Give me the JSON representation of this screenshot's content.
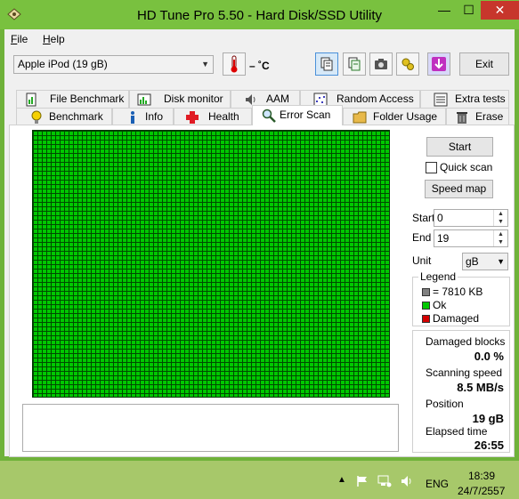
{
  "window": {
    "title": "HD Tune Pro 5.50 - Hard Disk/SSD Utility",
    "minimize_glyph": "—",
    "maximize_glyph": "☐",
    "close_glyph": "✕"
  },
  "menu": {
    "file": {
      "accel": "F",
      "rest": "ile"
    },
    "help": {
      "accel": "H",
      "rest": "elp"
    }
  },
  "toolbar": {
    "drive": "Apple   iPod (19 gB)",
    "temperature": "– ˚C",
    "exit_label": "Exit",
    "icons": [
      "thermometer-icon",
      "copy-info-icon",
      "copy-text-icon",
      "camera-icon",
      "options-icon",
      "save-icon"
    ]
  },
  "tabs": {
    "row1": [
      {
        "label": "File Benchmark",
        "icon": "file-benchmark-icon"
      },
      {
        "label": "Disk monitor",
        "icon": "disk-monitor-icon"
      },
      {
        "label": "AAM",
        "icon": "speaker-icon"
      },
      {
        "label": "Random Access",
        "icon": "random-access-icon"
      },
      {
        "label": "Extra tests",
        "icon": "extra-tests-icon"
      }
    ],
    "row2": [
      {
        "label": "Benchmark",
        "icon": "lightbulb-icon"
      },
      {
        "label": "Info",
        "icon": "info-icon"
      },
      {
        "label": "Health",
        "icon": "health-cross-icon"
      },
      {
        "label": "Error Scan",
        "icon": "magnifier-icon"
      },
      {
        "label": "Folder Usage",
        "icon": "folder-icon"
      },
      {
        "label": "Erase",
        "icon": "trash-icon"
      }
    ],
    "active": "Error Scan"
  },
  "scan": {
    "start_label": "Start",
    "quick_scan_label": "Quick scan",
    "quick_scan_checked": false,
    "speed_map_label": "Speed map",
    "start_field_label": "Start",
    "start_value": "0",
    "end_field_label": "End",
    "end_value": "19",
    "unit_label": "Unit",
    "unit_value": "gB",
    "legend": {
      "title": "Legend",
      "block_size": "= 7810 KB",
      "ok": "Ok",
      "damaged": "Damaged",
      "colors": {
        "block": "#808080",
        "ok": "#00c800",
        "damaged": "#d40000"
      }
    },
    "grid_color": "#00c800",
    "stats": {
      "damaged_blocks_label": "Damaged blocks",
      "damaged_blocks_value": "0.0 %",
      "scanning_speed_label": "Scanning speed",
      "scanning_speed_value": "8.5 MB/s",
      "position_label": "Position",
      "position_value": "19 gB",
      "elapsed_label": "Elapsed time",
      "elapsed_value": "26:55"
    }
  },
  "taskbar": {
    "language": "ENG",
    "time": "18:39",
    "date": "24/7/2557",
    "tray_icons": [
      "show-hidden-icon",
      "flag-icon",
      "network-icon",
      "volume-icon"
    ]
  }
}
